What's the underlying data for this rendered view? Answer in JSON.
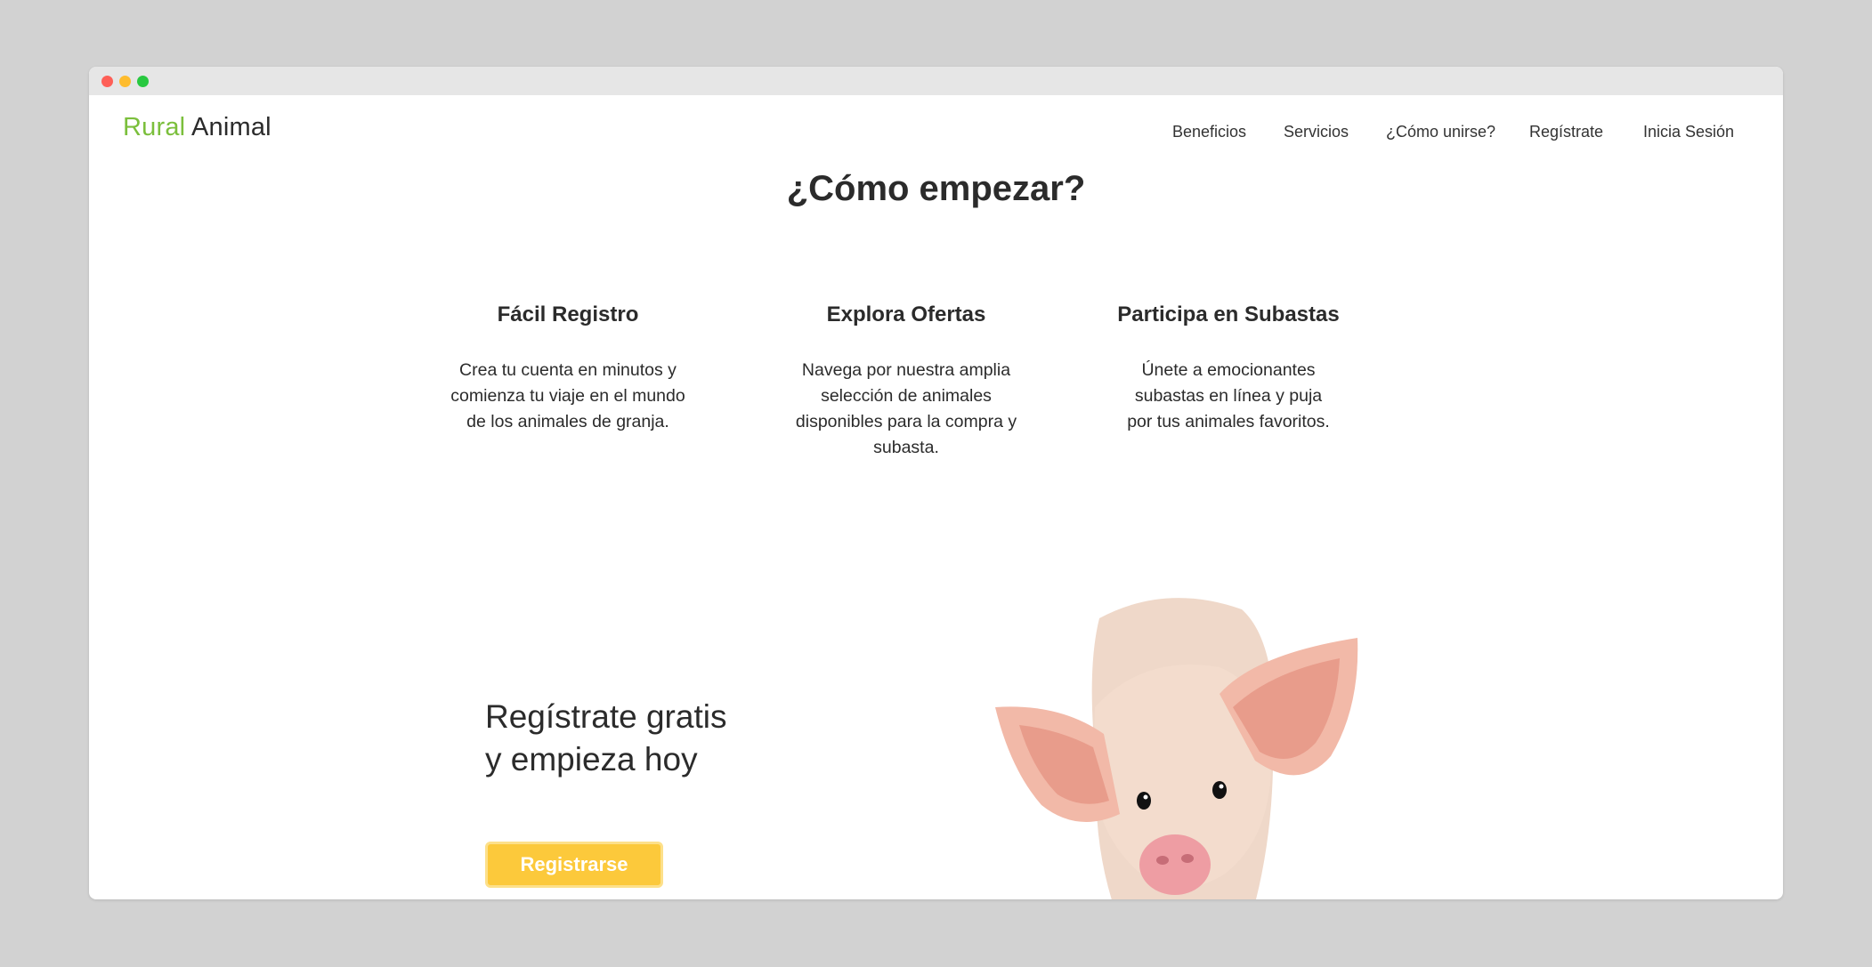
{
  "logo": {
    "part1": "Rural",
    "part2": "Animal"
  },
  "nav": {
    "items": [
      "Beneficios",
      "Servicios",
      "¿Cómo unirse?",
      "Regístrate",
      "Inicia Sesión"
    ]
  },
  "section": {
    "title": "¿Cómo empezar?"
  },
  "features": [
    {
      "title": "Fácil Registro",
      "lines": [
        "Crea tu cuenta en minutos y",
        "comienza tu viaje en el mundo",
        "de los animales de granja."
      ]
    },
    {
      "title": "Explora Ofertas",
      "lines": [
        "Navega por nuestra amplia",
        "selección de animales",
        "disponibles para la compra y",
        "subasta."
      ]
    },
    {
      "title": "Participa en Subastas",
      "lines": [
        "Únete a emocionantes",
        "subastas en línea y puja",
        "por tus animales favoritos."
      ]
    }
  ],
  "cta": {
    "heading_line1": "Regístrate gratis",
    "heading_line2": "y empieza hoy",
    "button_label": "Registrarse"
  },
  "colors": {
    "brand_green": "#7bbf3c",
    "button_yellow": "#fcc93b"
  },
  "image": {
    "subject": "pig-photo"
  }
}
